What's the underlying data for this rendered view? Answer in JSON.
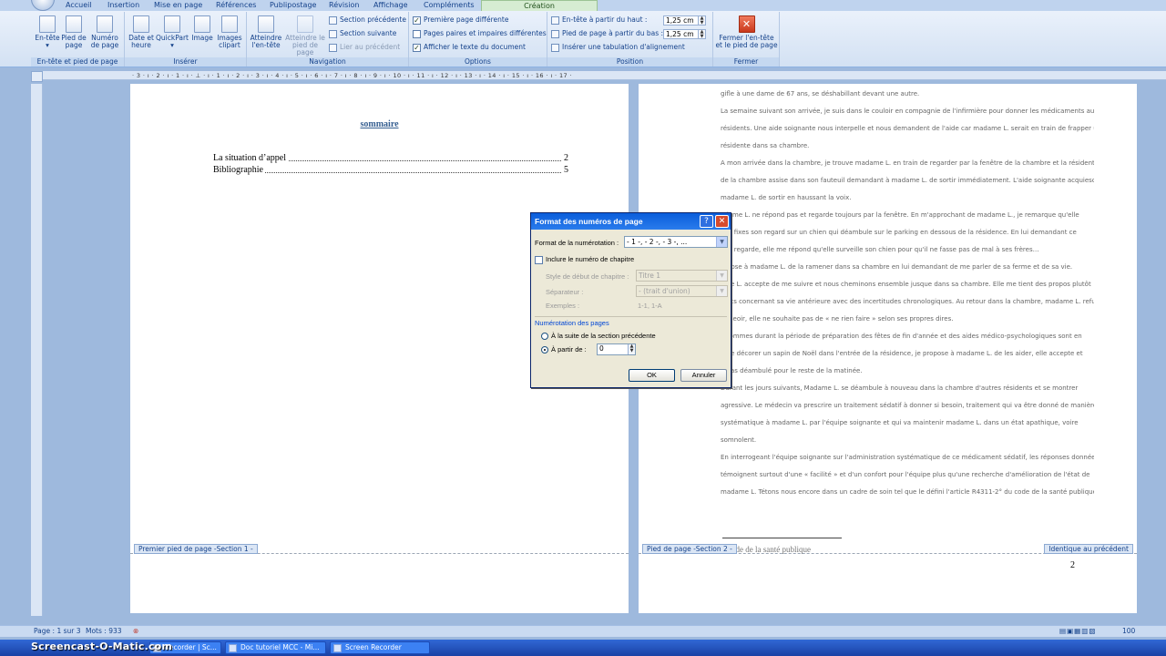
{
  "tabs": [
    "Accueil",
    "Insertion",
    "Mise en page",
    "Références",
    "Publipostage",
    "Révision",
    "Affichage",
    "Compléments",
    "Création"
  ],
  "ribbon": {
    "group_headerfooter": {
      "label": "En-tête et pied de page",
      "header": "En-tête",
      "footer": "Pied de page",
      "pagenum": "Numéro de page"
    },
    "group_insert": {
      "label": "Insérer",
      "datetime": "Date et heure",
      "quickpart": "QuickPart",
      "image": "Image",
      "clipart": "Images clipart"
    },
    "group_nav": {
      "label": "Navigation",
      "goto_header": "Atteindre l'en-tête",
      "goto_footer": "Atteindre le pied de page",
      "prev_section": "Section précédente",
      "next_section": "Section suivante",
      "link_prev": "Lier au précédent"
    },
    "group_options": {
      "label": "Options",
      "first_page": "Première page différente",
      "odd_even": "Pages paires et impaires différentes",
      "show_text": "Afficher le texte du document"
    },
    "group_position": {
      "label": "Position",
      "header_top": "En-tête à partir du haut :",
      "header_top_val": "1,25 cm",
      "footer_bottom": "Pied de page à partir du bas :",
      "footer_bottom_val": "1,25 cm",
      "align_tab": "Insérer une tabulation d'alignement"
    },
    "group_close": {
      "label": "Fermer",
      "close": "Fermer l'en-tête et le pied de page"
    }
  },
  "ruler_text": "· 3 · ı · 2 · ı · 1 · ı · ⊥ · ı · 1 · ı · 2 · ı · 3 · ı · 4 · ı · 5 · ı · 6 · ı · 7 · ı · 8 · ı · 9 · ı · 10 · ı · 11 · ı · 12 · ı · 13 · ı · 14 · ı · 15 · ı · 16 · ı · 17 ·",
  "page1": {
    "title": "sommaire",
    "toc": [
      {
        "text": "La situation d’appel",
        "page": "2"
      },
      {
        "text": "Bibliographie",
        "page": "5"
      }
    ],
    "footer_tag": "Premier pied de page -Section 1 -"
  },
  "page2": {
    "lines": [
      "gifle à une dame de 67 ans, se déshabillant devant une autre.",
      "La semaine suivant son arrivée, je suis dans le couloir en compagnie de l'infirmière pour donner les médicaments aux",
      "résidents. Une aide soignante nous interpelle et nous demandent de l'aide car madame L. serait en train de frapper une",
      "résidente dans sa chambre.",
      "A mon arrivée dans la chambre, je trouve madame L. en train de regarder par la fenêtre de la chambre et la résidente",
      "de la chambre assise dans son fauteuil demandant à madame L. de sortir immédiatement. L'aide soignante acquiesce à",
      "madame L. de sortir en haussant la voix.",
      "adame L. ne répond pas et regarde toujours par la fenêtre. En m'approchant de madame L., je remarque qu'elle",
      "elle fixes son regard sur un chien qui déambule sur le parking en dessous de la résidence. En lui demandant ce",
      "elle regarde, elle me répond qu'elle surveille son chien pour qu'il ne fasse pas de mal à ses frères…",
      "ropose à madame L. de la ramener dans sa chambre en lui demandant de me parler de sa ferme et de sa vie.",
      "ame L. accepte de me suivre et nous cheminons ensemble jusque dans sa chambre. Elle me tient des propos plutôt",
      "rents concernant sa vie antérieure avec des incertitudes chronologiques. Au retour dans la chambre, madame L. refuse",
      "'asseoir, elle ne souhaite pas de « ne rien faire » selon ses propres dires.",
      "s sommes durant la période de préparation des fêtes de fin d'année et des aides médico-psychologiques sont en",
      "n de décorer un sapin de Noël dans l'entrée de la résidence, je propose à madame L. de les aider, elle accepte et",
      "a pas déambulé pour le reste de la matinée.",
      "Durant les jours suivants, Madame L. se déambule à nouveau dans la chambre d'autres résidents et se montrer",
      "agressive. Le médecin va prescrire un traitement sédatif à donner si besoin, traitement qui va être donné de manière",
      "systématique à madame L. par l'équipe soignante et qui va maintenir madame L. dans un état apathique, voire",
      "somnolent.",
      "En interrogeant l'équipe soignante sur l'administration systématique de ce médicament sédatif, les réponses données",
      "témoignent surtout d'une « facilité » et d'un confort pour l'équipe plus qu'une recherche d'amélioration de l'état de",
      "madame L. Tétons nous encore dans un cadre de soin tel que le défini l'article R4311-2° du code de la santé publique"
    ],
    "footer_tag": "Pied de page -Section 2 -",
    "same_as_prev": "Identique au précédent",
    "footer_text": "Code de la santé publique",
    "page_number": "2"
  },
  "dialog": {
    "title": "Format des numéros de page",
    "format_label": "Format de la numérotation :",
    "format_value": "- 1 -, - 2 -, - 3 -, ...",
    "include_chapter": "Inclure le numéro de chapitre",
    "chapter_style_label": "Style de début de chapitre :",
    "chapter_style_value": "Titre 1",
    "separator_label": "Séparateur :",
    "separator_value": "-     (trait d'union)",
    "examples_label": "Exemples :",
    "examples_value": "1-1, 1-A",
    "numbering_group": "Numérotation des pages",
    "continue_option": "À la suite de la section précédente",
    "start_at_option": "À partir de :",
    "start_at_value": "0",
    "ok": "OK",
    "cancel": "Annuler"
  },
  "status": {
    "page": "Page : 1 sur 3",
    "words": "Mots : 933",
    "zoom": "100"
  },
  "taskbar": [
    {
      "label": "Recorder | Sc..."
    },
    {
      "label": "Doc tutoriel MCC - Mi..."
    },
    {
      "label": "Screen Recorder"
    }
  ],
  "watermark": "Screencast-O-Matic.com"
}
